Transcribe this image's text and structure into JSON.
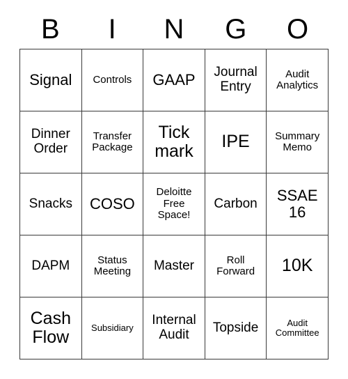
{
  "card": {
    "header_letters": [
      "B",
      "I",
      "N",
      "G",
      "O"
    ],
    "rows": [
      [
        {
          "label": "Signal",
          "size": "lg"
        },
        {
          "label": "Controls",
          "size": "sm"
        },
        {
          "label": "GAAP",
          "size": "lg"
        },
        {
          "label": "Journal\nEntry",
          "size": "md"
        },
        {
          "label": "Audit\nAnalytics",
          "size": "sm"
        }
      ],
      [
        {
          "label": "Dinner\nOrder",
          "size": "md"
        },
        {
          "label": "Transfer\nPackage",
          "size": "sm"
        },
        {
          "label": "Tick\nmark",
          "size": "xl"
        },
        {
          "label": "IPE",
          "size": "xl"
        },
        {
          "label": "Summary\nMemo",
          "size": "sm"
        }
      ],
      [
        {
          "label": "Snacks",
          "size": "md"
        },
        {
          "label": "COSO",
          "size": "lg"
        },
        {
          "label": "Deloitte\nFree\nSpace!",
          "size": "sm"
        },
        {
          "label": "Carbon",
          "size": "md"
        },
        {
          "label": "SSAE\n16",
          "size": "lg"
        }
      ],
      [
        {
          "label": "DAPM",
          "size": "md"
        },
        {
          "label": "Status\nMeeting",
          "size": "sm"
        },
        {
          "label": "Master",
          "size": "md"
        },
        {
          "label": "Roll\nForward",
          "size": "sm"
        },
        {
          "label": "10K",
          "size": "xl"
        }
      ],
      [
        {
          "label": "Cash\nFlow",
          "size": "xl"
        },
        {
          "label": "Subsidiary",
          "size": "xs"
        },
        {
          "label": "Internal\nAudit",
          "size": "md"
        },
        {
          "label": "Topside",
          "size": "md"
        },
        {
          "label": "Audit\nCommittee",
          "size": "xs"
        }
      ]
    ]
  }
}
